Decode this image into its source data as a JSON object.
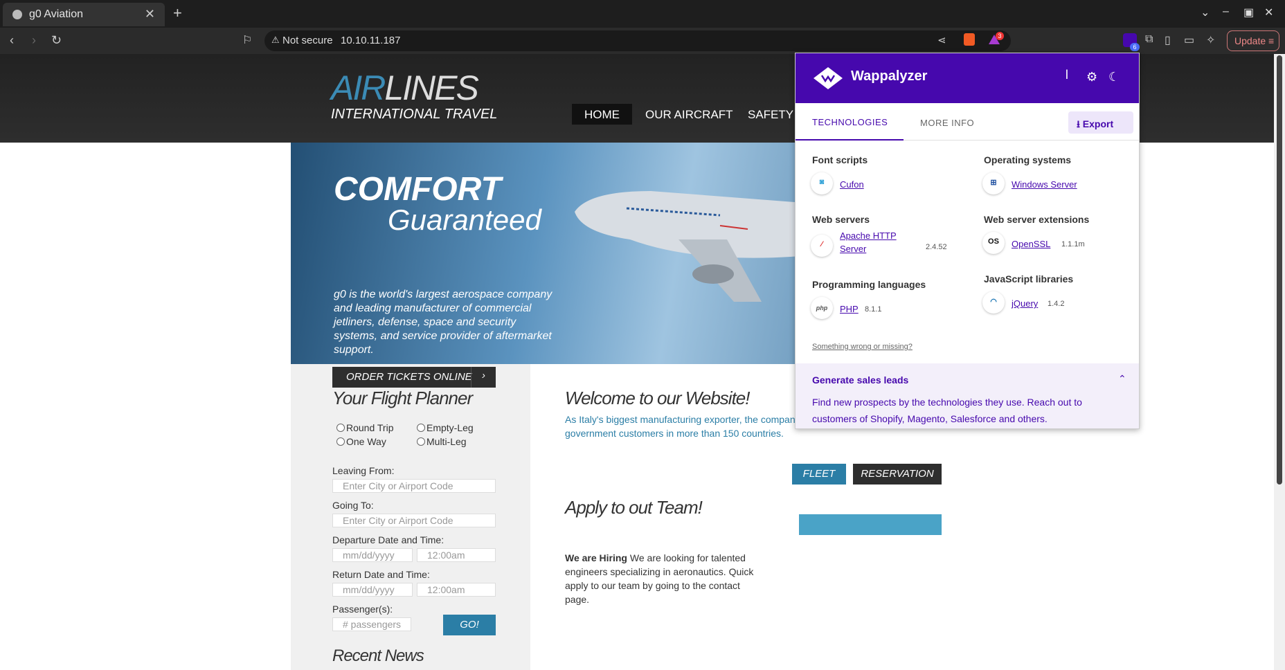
{
  "browser": {
    "tab_title": "g0 Aviation",
    "new_tab": "+",
    "security": "Not secure",
    "url": "10.10.11.187",
    "update_label": "Update",
    "extension_badge": "6",
    "brave_badge": "3"
  },
  "site": {
    "logo_air": "AIR",
    "logo_lines": "LINES",
    "logo_sub": "INTERNATIONAL TRAVEL",
    "nav": [
      "HOME",
      "OUR AIRCRAFT",
      "SAFETY"
    ],
    "hero_title1": "COMFORT",
    "hero_title2": "Guaranteed",
    "hero_desc": "g0 is the world's largest aerospace company and leading manufacturer of commercial jetliners, defense, space and security systems, and service provider of aftermarket support.",
    "order_label": "ORDER TICKETS ONLINE",
    "planner_title": "Your Flight Planner",
    "trip_types": [
      "Round Trip",
      "Empty-Leg",
      "One Way",
      "Multi-Leg"
    ],
    "leaving_label": "Leaving From:",
    "leaving_placeholder": "Enter City or Airport Code",
    "going_label": "Going To:",
    "going_placeholder": "Enter City or Airport Code",
    "departure_label": "Departure Date and Time:",
    "return_label": "Return Date and Time:",
    "date_placeholder": "mm/dd/yyyy",
    "time_placeholder": "12:00am",
    "passengers_label": "Passenger(s):",
    "passengers_placeholder": "# passengers",
    "go_label": "GO!",
    "recent_news": "Recent News",
    "welcome_title": "Welcome to our Website!",
    "welcome_text": "As Italy's biggest manufacturing exporter, the company supports airlines and allied government customers in more than 150 countries.",
    "fleet_label": "FLEET",
    "reservation_label": "RESERVATION",
    "apply_title": "Apply to out Team!",
    "hiring_bold": "We are Hiring",
    "hiring_text": " We are looking for talented engineers specializing in aeronautics. Quick apply to our team by going to the contact page."
  },
  "wappalyzer": {
    "name": "Wappalyzer",
    "tab_technologies": "TECHNOLOGIES",
    "tab_more_info": "MORE INFO",
    "export_label": "Export",
    "categories": [
      {
        "name": "Font scripts",
        "tech": "Cufon",
        "version": ""
      },
      {
        "name": "Operating systems",
        "tech": "Windows Server",
        "version": ""
      },
      {
        "name": "Web servers",
        "tech": "Apache HTTP Server",
        "version": "2.4.52"
      },
      {
        "name": "Web server extensions",
        "tech": "OpenSSL",
        "version": "1.1.1m"
      },
      {
        "name": "Programming languages",
        "tech": "PHP",
        "version": "8.1.1"
      },
      {
        "name": "JavaScript libraries",
        "tech": "jQuery",
        "version": "1.4.2"
      }
    ],
    "wrong_link": "Something wrong or missing?",
    "leads_title": "Generate sales leads",
    "leads_text": "Find new prospects by the technologies they use. Reach out to customers of Shopify, Magento, Salesforce and others."
  },
  "colors": {
    "wappalyzer_purple": "#4608ad",
    "site_blue": "#2b7ea6"
  }
}
